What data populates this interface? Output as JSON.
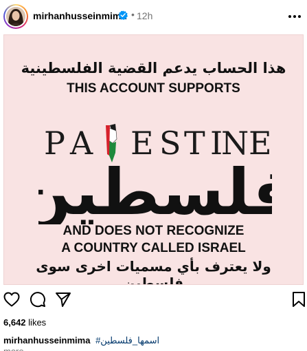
{
  "header": {
    "username": "mirhanhusseinmima",
    "separator": "•",
    "time": "12h"
  },
  "post": {
    "arabic_top": "هذا الحساب يدعم القضية الفلسطينية",
    "english_top": "THIS ACCOUNT SUPPORTS",
    "logo_latin": "PALESTINE",
    "logo_arabic": "فلسطين",
    "english_bottom_1": "AND DOES NOT RECOGNIZE",
    "english_bottom_2": "A COUNTRY CALLED ISRAEL",
    "arabic_bottom": "ولا يعترف بأي مسميات اخرى سوى فلسطين",
    "colors": {
      "background": "#f9e3e3",
      "flag_red": "#d6212b",
      "flag_green": "#1e8a3c",
      "flag_black": "#111111"
    }
  },
  "engagement": {
    "likes_count": "6,642",
    "likes_label": "likes"
  },
  "caption": {
    "username": "mirhanhusseinmima",
    "hashtag": "#اسمها_فلسطين",
    "more": "more"
  },
  "icons": {
    "verified": "verified-badge-icon",
    "more": "more-options-icon",
    "like": "heart-icon",
    "comment": "comment-icon",
    "share": "share-icon",
    "save": "bookmark-icon"
  }
}
